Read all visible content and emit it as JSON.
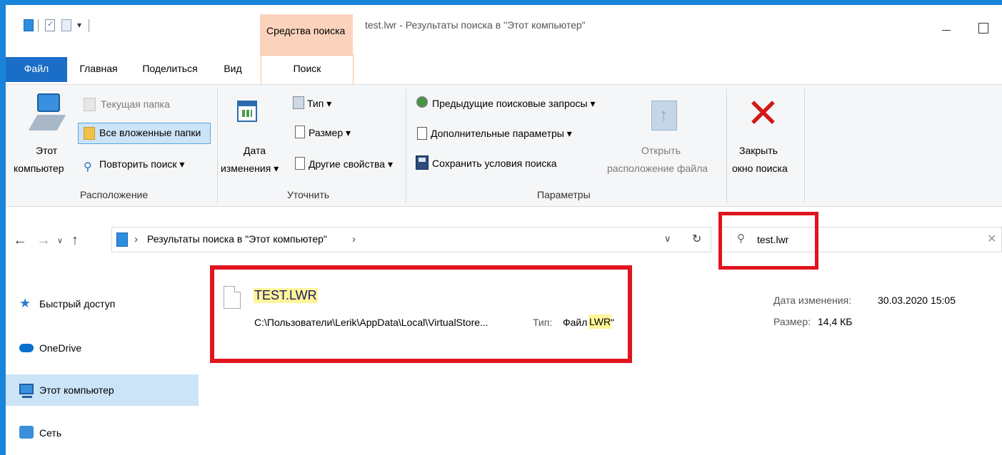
{
  "window": {
    "title": "test.lwr - Результаты поиска в \"Этот компьютер\"",
    "context_tab_group": "Средства поиска"
  },
  "qat": {
    "dropdown_glyph": "▾"
  },
  "tabs": {
    "file": "Файл",
    "home": "Главная",
    "share": "Поделиться",
    "view": "Вид",
    "search": "Поиск"
  },
  "ribbon": {
    "location": {
      "group_label": "Расположение",
      "this_pc_line1": "Этот",
      "this_pc_line2": "компьютер",
      "current_folder": "Текущая папка",
      "all_subfolders": "Все вложенные папки",
      "repeat_search": "Повторить поиск ▾"
    },
    "refine": {
      "group_label": "Уточнить",
      "date_line1": "Дата",
      "date_line2": "изменения ▾",
      "type": "Тип ▾",
      "size": "Размер ▾",
      "other_props": "Другие свойства ▾"
    },
    "options": {
      "group_label": "Параметры",
      "recent_searches": "Предыдущие поисковые запросы ▾",
      "advanced_options": "Дополнительные параметры ▾",
      "save_search": "Сохранить условия поиска",
      "open_location_line1": "Открыть",
      "open_location_line2": "расположение файла"
    },
    "close": {
      "line1": "Закрыть",
      "line2": "окно поиска"
    }
  },
  "address": {
    "path": "Результаты поиска в \"Этот компьютер\"",
    "chevron": "›"
  },
  "search": {
    "value": "test.lwr"
  },
  "nav": {
    "quick_access": "Быстрый доступ",
    "onedrive": "OneDrive",
    "this_pc": "Этот компьютер",
    "network": "Сеть"
  },
  "result": {
    "name": "TEST.LWR",
    "path": "C:\\Пользователи\\Lerik\\AppData\\Local\\VirtualStore...",
    "type_label": "Тип:",
    "type_value": "Файл \"",
    "type_highlight": "LWR",
    "type_close": "\""
  },
  "details": {
    "modified_label": "Дата изменения:",
    "modified_value": "30.03.2020 15:05",
    "size_label": "Размер:",
    "size_value": "14,4 КБ"
  },
  "colors": {
    "accent": "#1a84d8",
    "file_tab": "#1a6ec7",
    "context_tab": "#fbd3bd",
    "highlight_box": "#e0141e",
    "search_match": "#fff59a",
    "selection": "#cce4f7"
  }
}
